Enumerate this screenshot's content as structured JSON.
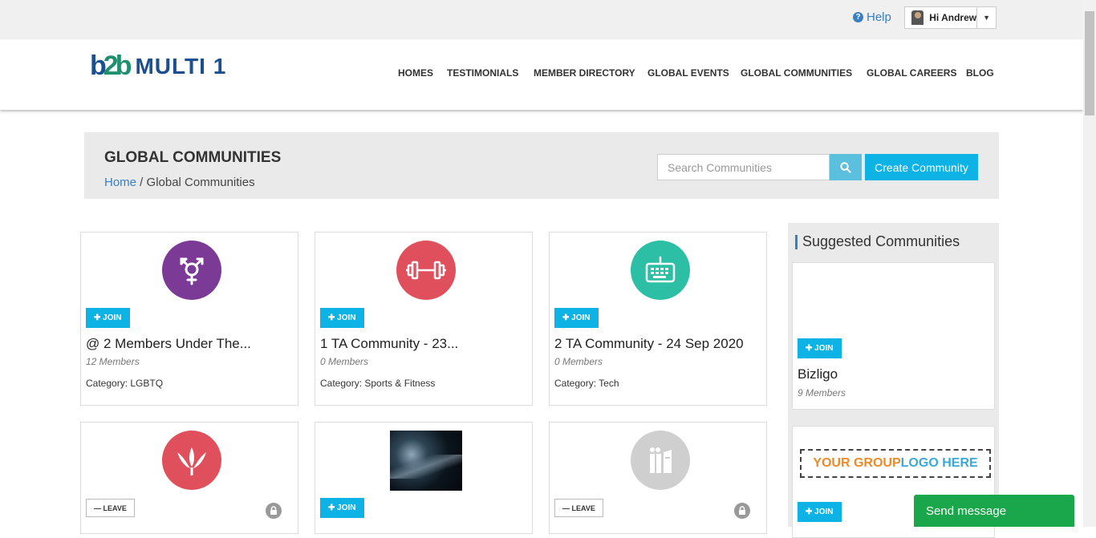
{
  "topbar": {
    "help_label": "Help",
    "user_greeting": "Hi Andrew"
  },
  "brand": {
    "logo_mark_b1": "b",
    "logo_mark_2": "2",
    "logo_mark_b2": "b",
    "logo_text": "MULTI 1"
  },
  "nav": [
    {
      "label": "HOMES"
    },
    {
      "label": "TESTIMONIALS"
    },
    {
      "label": "MEMBER DIRECTORY"
    },
    {
      "label": "GLOBAL EVENTS"
    },
    {
      "label": "GLOBAL COMMUNITIES"
    },
    {
      "label": "GLOBAL CAREERS"
    },
    {
      "label": "BLOG"
    }
  ],
  "banner": {
    "title": "GLOBAL COMMUNITIES",
    "breadcrumb_home": "Home",
    "breadcrumb_sep": " / ",
    "breadcrumb_current": "Global Communities",
    "search_placeholder": "Search Communities",
    "create_label": "Create Community"
  },
  "buttons": {
    "join": "JOIN",
    "leave": "LEAVE"
  },
  "communities": [
    {
      "title": "@ 2 Members Under The...",
      "members": "12 Members",
      "category": "Category: LGBTQ",
      "icon": "transgender-icon",
      "color": "#7b3a96"
    },
    {
      "title": "1 TA Community - 23...",
      "members": "0 Members",
      "category": "Category: Sports & Fitness",
      "icon": "dumbbell-icon",
      "color": "#e0505c"
    },
    {
      "title": "2 TA Community - 24 Sep 2020",
      "members": "0 Members",
      "category": "Category: Tech",
      "icon": "keyboard-icon",
      "color": "#2dbfa5"
    },
    {
      "icon": "lotus-icon",
      "color": "#e0505c",
      "action": "LEAVE",
      "locked": true
    },
    {
      "icon": "space-photo",
      "color": "#1a2633",
      "action": "JOIN",
      "locked": false
    },
    {
      "icon": "book-icon",
      "color": "#cfcfcf",
      "action": "LEAVE",
      "locked": true
    }
  ],
  "sidebar": {
    "title": "Suggested Communities",
    "items": [
      {
        "title": "Bizligo",
        "members": "9 Members"
      },
      {
        "logo_part1": "YOUR GROUP ",
        "logo_part2": "LOGO HERE"
      }
    ]
  },
  "chat": {
    "label": "Send message"
  }
}
